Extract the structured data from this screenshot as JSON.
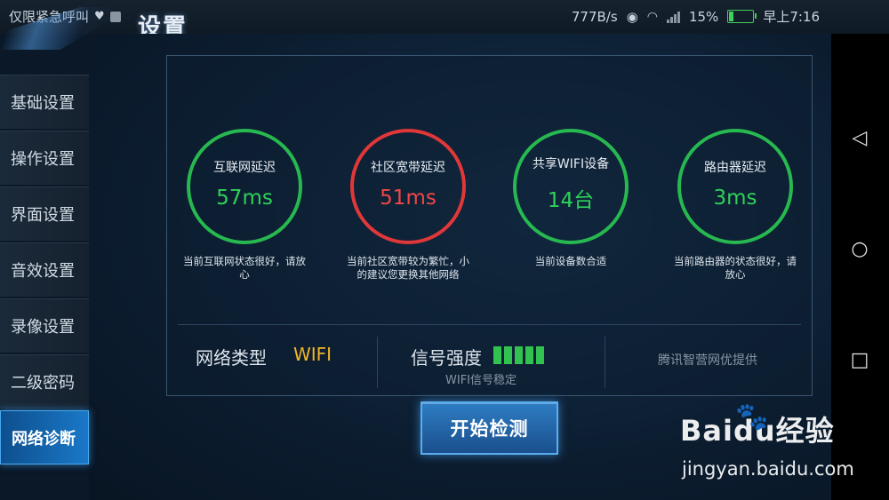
{
  "status_bar": {
    "left_text": "仅限紧急呼叫",
    "speed": "777B/s",
    "battery": "15%",
    "time": "早上7:16"
  },
  "header": {
    "title": "设置"
  },
  "sidebar": {
    "items": [
      {
        "label": "基础设置"
      },
      {
        "label": "操作设置"
      },
      {
        "label": "界面设置"
      },
      {
        "label": "音效设置"
      },
      {
        "label": "录像设置"
      },
      {
        "label": "二级密码"
      },
      {
        "label": "网络诊断",
        "active": true
      }
    ]
  },
  "gauges": [
    {
      "label": "互联网延迟",
      "value": "57ms",
      "status": "good",
      "color": "#27b850",
      "desc": "当前互联网状态很好，请放心"
    },
    {
      "label": "社区宽带延迟",
      "value": "51ms",
      "status": "bad",
      "color": "#e03838",
      "desc": "当前社区宽带较为繁忙，小的建议您更换其他网络"
    },
    {
      "label": "共享WIFI设备",
      "value": "14台",
      "status": "good",
      "color": "#27b850",
      "desc": "当前设备数合适"
    },
    {
      "label": "路由器延迟",
      "value": "3ms",
      "status": "good",
      "color": "#27b850",
      "desc": "当前路由器的状态很好，请放心"
    }
  ],
  "network": {
    "type_label": "网络类型",
    "type_value": "WIFI",
    "signal_label": "信号强度",
    "signal_bars": 5,
    "signal_bars_filled": 5,
    "signal_sub": "WIFI信号稳定",
    "provider": "腾讯智营网优提供"
  },
  "actions": {
    "start_label": "开始检测"
  },
  "watermark": {
    "brand": "Baidu经验",
    "site": "jingyan.baidu.com"
  },
  "colors": {
    "good": "#27b850",
    "bad": "#e03838",
    "wifi": "#f0b528",
    "accent": "#1a78c8"
  },
  "nav_icons": [
    "back-triangle-icon",
    "home-circle-icon",
    "recents-square-icon"
  ]
}
